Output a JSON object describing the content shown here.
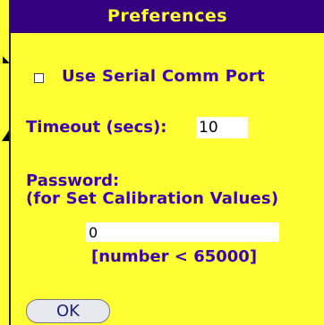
{
  "window": {
    "title": "Preferences"
  },
  "settings": {
    "serial_label": "Use Serial Comm Port",
    "timeout_label": "Timeout (secs):",
    "timeout_value": "10",
    "password_label": "Password:",
    "password_subtitle": "(for Set Calibration Values)",
    "password_value": "0",
    "password_hint": "[number < 65000]"
  },
  "buttons": {
    "ok_label": "OK"
  },
  "colors": {
    "title_bg": "#33007f",
    "title_text": "#ffff33",
    "background": "#ffff33",
    "label_text": "#3f00b0"
  }
}
